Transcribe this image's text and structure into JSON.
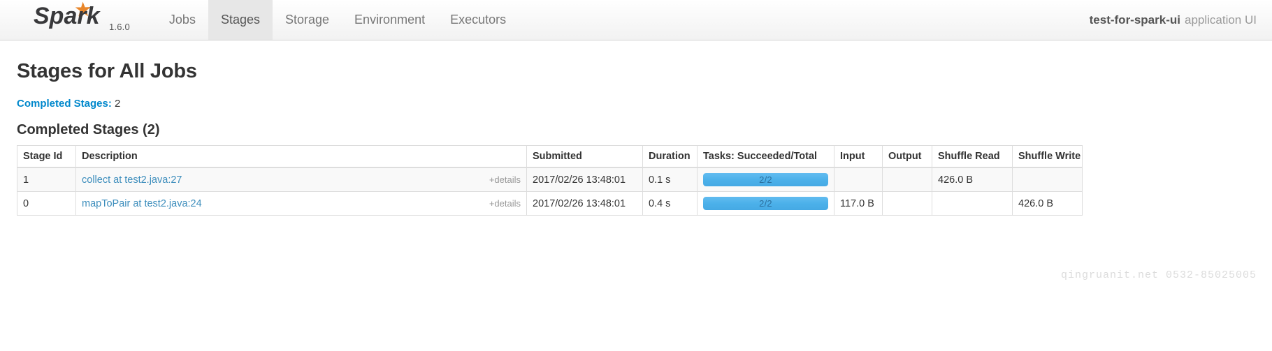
{
  "navbar": {
    "brand": {
      "logo_icon": "spark-logo",
      "version": "1.6.0"
    },
    "tabs": [
      {
        "label": "Jobs",
        "active": false
      },
      {
        "label": "Stages",
        "active": true
      },
      {
        "label": "Storage",
        "active": false
      },
      {
        "label": "Environment",
        "active": false
      },
      {
        "label": "Executors",
        "active": false
      }
    ],
    "app": {
      "name": "test-for-spark-ui",
      "suffix": "application UI"
    }
  },
  "main": {
    "page_title": "Stages for All Jobs",
    "summary": {
      "label": "Completed Stages:",
      "value": "2"
    },
    "section_title": "Completed Stages (2)",
    "table": {
      "headers": [
        "Stage Id",
        "Description",
        "Submitted",
        "Duration",
        "Tasks: Succeeded/Total",
        "Input",
        "Output",
        "Shuffle Read",
        "Shuffle Write"
      ],
      "rows": [
        {
          "stage_id": "1",
          "description": "collect at test2.java:27",
          "details_label": "+details",
          "submitted": "2017/02/26 13:48:01",
          "duration": "0.1 s",
          "tasks_label": "2/2",
          "tasks_percent": 100,
          "input": "",
          "output": "",
          "shuffle_read": "426.0 B",
          "shuffle_write": ""
        },
        {
          "stage_id": "0",
          "description": "mapToPair at test2.java:24",
          "details_label": "+details",
          "submitted": "2017/02/26 13:48:01",
          "duration": "0.4 s",
          "tasks_label": "2/2",
          "tasks_percent": 100,
          "input": "117.0 B",
          "output": "",
          "shuffle_read": "",
          "shuffle_write": "426.0 B"
        }
      ]
    }
  },
  "watermark": "qingruanit.net 0532-85025005",
  "colors": {
    "link": "#3c8dbc",
    "summary_link": "#0088cc",
    "progress_fill": "#4cb1ea",
    "progress_text": "#2b6f9e",
    "active_tab_bg": "#e7e7e7"
  }
}
